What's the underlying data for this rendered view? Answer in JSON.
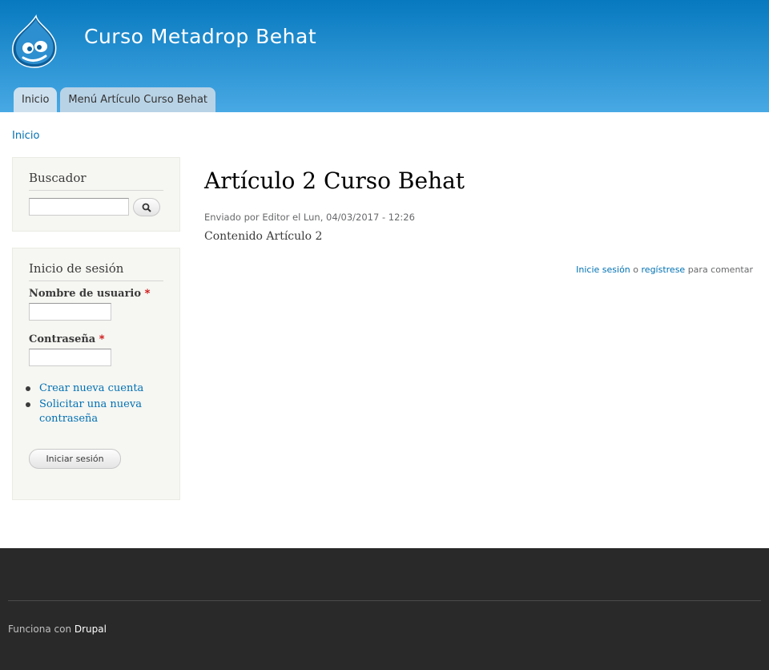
{
  "header": {
    "site_name": "Curso Metadrop Behat",
    "menu": [
      {
        "label": "Inicio"
      },
      {
        "label": "Menú Artículo Curso Behat"
      }
    ]
  },
  "breadcrumb": {
    "home": "Inicio"
  },
  "search_block": {
    "title": "Buscador",
    "input_value": "",
    "button_icon": "search-icon"
  },
  "login_block": {
    "title": "Inicio de sesión",
    "username_label": "Nombre de usuario",
    "password_label": "Contraseña",
    "required_marker": "*",
    "username_value": "",
    "password_value": "",
    "links": [
      {
        "label": "Crear nueva cuenta"
      },
      {
        "label": "Solicitar una nueva contraseña"
      }
    ],
    "submit_label": "Iniciar sesión"
  },
  "article": {
    "title": "Artículo 2 Curso Behat",
    "submitted": "Enviado por Editor el Lun, 04/03/2017 - 12:26",
    "body": "Contenido Artículo 2",
    "comment_login": "Inicie sesión",
    "comment_or": " o ",
    "comment_register": "regístrese",
    "comment_suffix": " para comentar"
  },
  "footer": {
    "powered_prefix": "Funciona con ",
    "powered_link": "Drupal"
  },
  "colors": {
    "header_top": "#0779bf",
    "header_bottom": "#48a9e4",
    "link": "#0071b3",
    "footer_bg": "#292929",
    "sidebar_bg": "#f6f6f2"
  }
}
